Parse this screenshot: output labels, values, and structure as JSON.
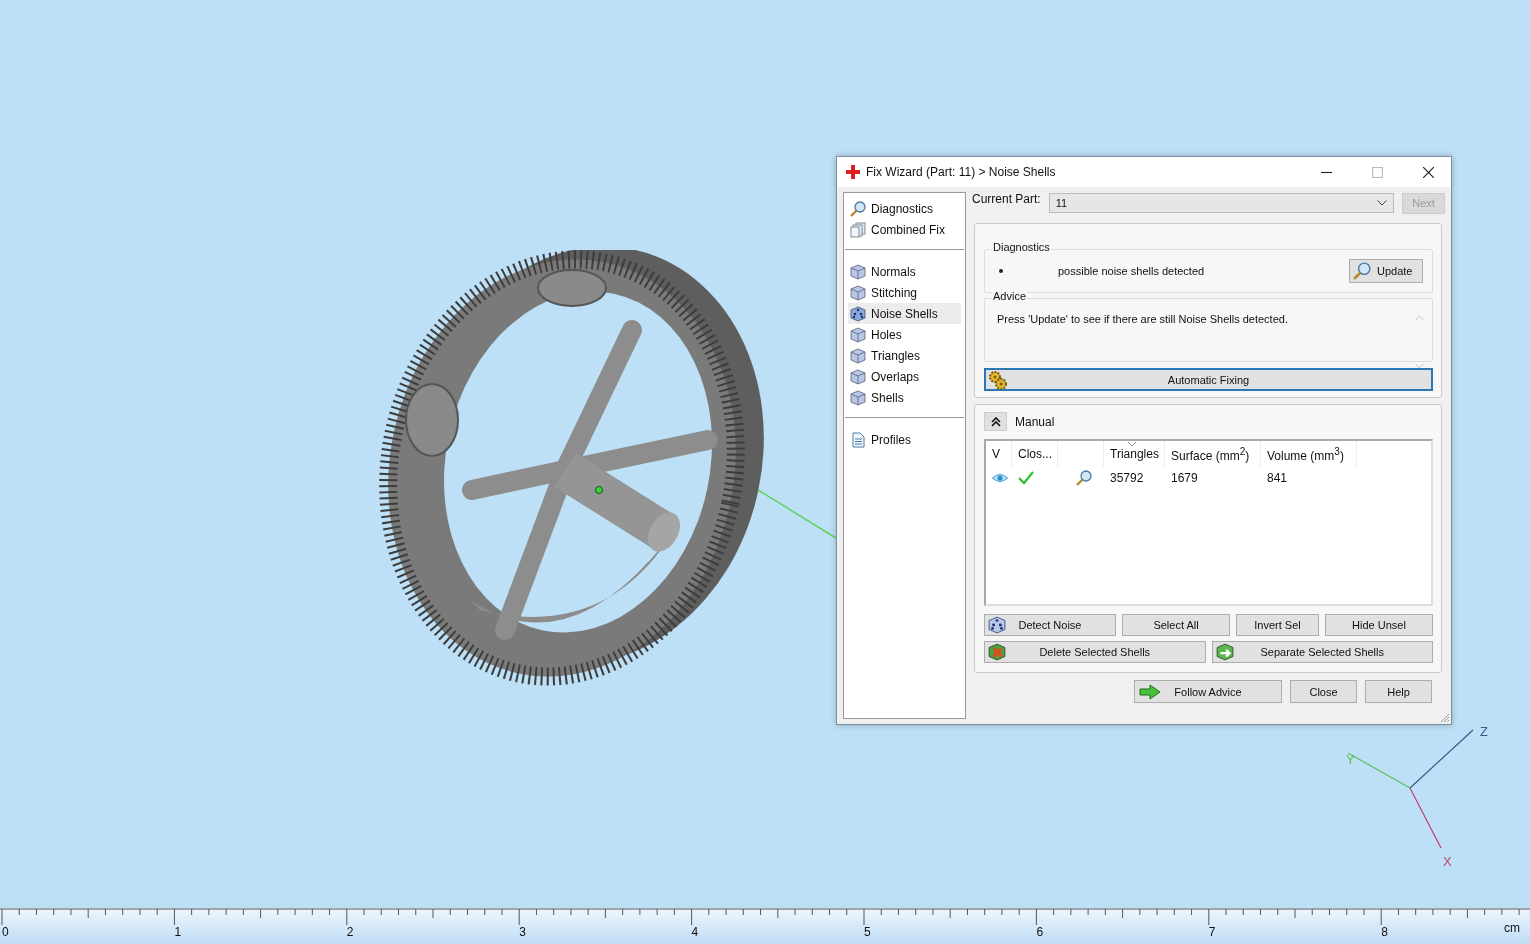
{
  "viewport": {
    "axes": [
      {
        "label": "Z",
        "color": "#3a5a8a"
      },
      {
        "label": "Y",
        "color": "#5cc25c"
      },
      {
        "label": "X",
        "color": "#c0406a"
      }
    ]
  },
  "ruler": {
    "labels": [
      "0",
      "1",
      "2",
      "3",
      "4",
      "5",
      "6",
      "7",
      "8"
    ],
    "unit": "cm"
  },
  "dialog": {
    "title": "Fix Wizard (Part: 11) > Noise Shells",
    "nav_groups": [
      [
        {
          "label": "Diagnostics",
          "kind": "search",
          "selected": false
        },
        {
          "label": "Combined Fix",
          "kind": "stack",
          "selected": false
        }
      ],
      [
        {
          "label": "Normals",
          "kind": "cube",
          "selected": false
        },
        {
          "label": "Stitching",
          "kind": "cube",
          "selected": false
        },
        {
          "label": "Noise Shells",
          "kind": "dice",
          "selected": true
        },
        {
          "label": "Holes",
          "kind": "cube",
          "selected": false
        },
        {
          "label": "Triangles",
          "kind": "cube",
          "selected": false
        },
        {
          "label": "Overlaps",
          "kind": "cube",
          "selected": false
        },
        {
          "label": "Shells",
          "kind": "cube",
          "selected": false
        }
      ],
      [
        {
          "label": "Profiles",
          "kind": "document",
          "selected": false
        }
      ]
    ],
    "part": {
      "label": "Current Part:",
      "value": "11"
    },
    "next": {
      "label": "Next",
      "disabled": true
    },
    "diagnostics": {
      "title": "Diagnostics",
      "message": "possible noise shells detected",
      "update_label": "Update"
    },
    "advice": {
      "title": "Advice",
      "text": "Press 'Update' to see if there are still Noise Shells detected."
    },
    "auto_fix": {
      "label": "Automatic Fixing",
      "focused": true
    },
    "manual": {
      "title": "Manual",
      "expanded": true,
      "columns": [
        {
          "label": "V",
          "sorted": false
        },
        {
          "label": "Clos...",
          "sorted": false
        },
        {
          "sorted": false
        },
        {
          "label": "Triangles",
          "sorted": true
        },
        {
          "label": "Surface (mm$^{2}$)",
          "sorted": false
        },
        {
          "label": "Volume (mm$^{3}$)",
          "sorted": false
        }
      ],
      "rows": [
        {
          "visible": true,
          "closed": true,
          "cells": [
            "",
            "",
            "",
            "35792",
            "1679",
            "841"
          ]
        }
      ],
      "button_rows": [
        [
          {
            "label": "Detect Noise",
            "kind": "dice"
          },
          {
            "label": "Select All",
            "kind": "plain"
          },
          {
            "label": "Invert Sel",
            "kind": "plain"
          },
          {
            "label": "Hide Unsel",
            "kind": "plain"
          }
        ],
        [
          {
            "label": "Delete Selected Shells",
            "kind": "delete"
          },
          {
            "label": "Separate Selected Shells",
            "kind": "separate"
          }
        ]
      ]
    },
    "footer_buttons": [
      {
        "label": "Follow Advice",
        "kind": "arrow"
      },
      {
        "label": "Close",
        "kind": "plain"
      },
      {
        "label": "Help",
        "kind": "plain"
      }
    ]
  }
}
